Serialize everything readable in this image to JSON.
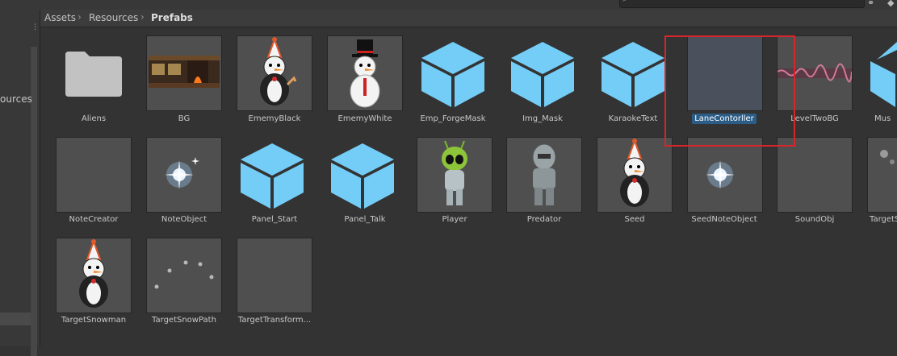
{
  "breadcrumb": {
    "items": [
      "Assets",
      "Resources",
      "Prefabs"
    ]
  },
  "left_panel": {
    "label": "ources"
  },
  "assets": [
    {
      "name": "Aliens",
      "type": "folder"
    },
    {
      "name": "BG",
      "type": "background"
    },
    {
      "name": "EmemyBlack",
      "type": "snowman-party"
    },
    {
      "name": "EmemyWhite",
      "type": "snowman-tophat"
    },
    {
      "name": "Emp_ForgeMask",
      "type": "cube"
    },
    {
      "name": "Img_Mask",
      "type": "cube"
    },
    {
      "name": "KaraokeText",
      "type": "cube"
    },
    {
      "name": "LaneContorller",
      "type": "empty",
      "selected": true
    },
    {
      "name": "LevelTwoBG",
      "type": "strip"
    },
    {
      "name": "Mus",
      "type": "cube"
    },
    {
      "name": "NoteCreator",
      "type": "empty"
    },
    {
      "name": "NoteObject",
      "type": "sparkle"
    },
    {
      "name": "Panel_Start",
      "type": "cube"
    },
    {
      "name": "Panel_Talk",
      "type": "cube"
    },
    {
      "name": "Player",
      "type": "alien"
    },
    {
      "name": "Predator",
      "type": "predator"
    },
    {
      "name": "Seed",
      "type": "snowman-party"
    },
    {
      "name": "SeedNoteObject",
      "type": "sparkle"
    },
    {
      "name": "SoundObj",
      "type": "empty"
    },
    {
      "name": "TargetS",
      "type": "dots"
    },
    {
      "name": "TargetSnowman",
      "type": "snowman-party"
    },
    {
      "name": "TargetSnowPath",
      "type": "dots"
    },
    {
      "name": "TargetTransform...",
      "type": "empty"
    }
  ],
  "colors": {
    "cube": "#74cdf7",
    "selection": "#2c5d87",
    "highlight_box": "#d6262b"
  }
}
